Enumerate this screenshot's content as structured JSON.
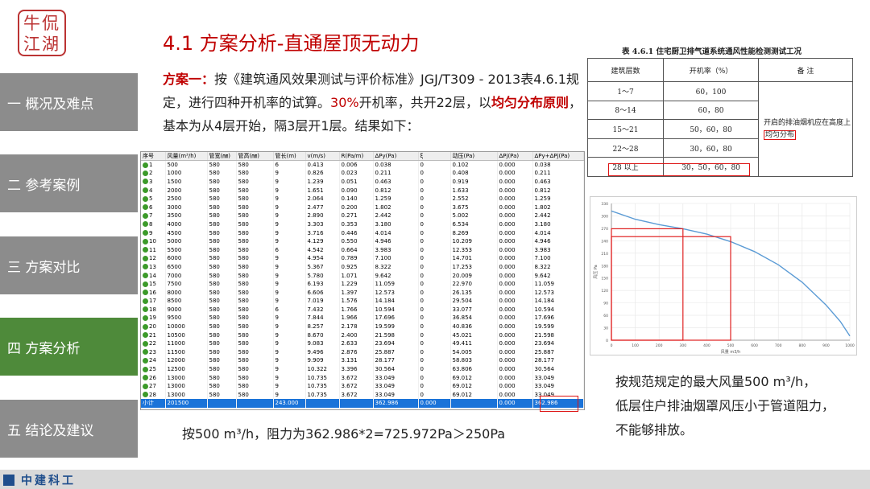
{
  "logo": {
    "text": "牛侃江湖"
  },
  "title": "4.1  方案分析-直通屋顶无动力",
  "sidebar": [
    {
      "label": "一 概况及难点",
      "active": false
    },
    {
      "label": "二 参考案例",
      "active": false
    },
    {
      "label": "三 方案对比",
      "active": false
    },
    {
      "label": "四 方案分析",
      "active": true
    },
    {
      "label": "五 结论及建议",
      "active": false
    }
  ],
  "paragraph": {
    "p1": "方案一：",
    "p2": "按《建筑通风效果测试与评价标准》JGJ/T309 - 2013表4.6.1规定，进行四种开机率的试算。",
    "p3": "30%",
    "p4": "开机率，共开22层，以",
    "p5": "均匀分布原则",
    "p6": "，基本为从4层开始，隔3层开1层。结果如下："
  },
  "calc_table": {
    "headers": [
      "序号",
      "风量(m³/h)",
      "管宽(㎜)",
      "管高(㎜)",
      "管长(m)",
      "v(m/s)",
      "R(Pa/m)",
      "ΔPy(Pa)",
      "ξ",
      "动压(Pa)",
      "ΔPj(Pa)",
      "ΔPy+ΔPj(Pa)"
    ],
    "rows": [
      [
        "1",
        "500",
        "580",
        "580",
        "6",
        "0.413",
        "0.006",
        "0.038",
        "0",
        "0.102",
        "0.000",
        "0.038"
      ],
      [
        "2",
        "1000",
        "580",
        "580",
        "9",
        "0.826",
        "0.023",
        "0.211",
        "0",
        "0.408",
        "0.000",
        "0.211"
      ],
      [
        "3",
        "1500",
        "580",
        "580",
        "9",
        "1.239",
        "0.051",
        "0.463",
        "0",
        "0.919",
        "0.000",
        "0.463"
      ],
      [
        "4",
        "2000",
        "580",
        "580",
        "9",
        "1.651",
        "0.090",
        "0.812",
        "0",
        "1.633",
        "0.000",
        "0.812"
      ],
      [
        "5",
        "2500",
        "580",
        "580",
        "9",
        "2.064",
        "0.140",
        "1.259",
        "0",
        "2.552",
        "0.000",
        "1.259"
      ],
      [
        "6",
        "3000",
        "580",
        "580",
        "9",
        "2.477",
        "0.200",
        "1.802",
        "0",
        "3.675",
        "0.000",
        "1.802"
      ],
      [
        "7",
        "3500",
        "580",
        "580",
        "9",
        "2.890",
        "0.271",
        "2.442",
        "0",
        "5.002",
        "0.000",
        "2.442"
      ],
      [
        "8",
        "4000",
        "580",
        "580",
        "9",
        "3.303",
        "0.353",
        "3.180",
        "0",
        "6.534",
        "0.000",
        "3.180"
      ],
      [
        "9",
        "4500",
        "580",
        "580",
        "9",
        "3.716",
        "0.446",
        "4.014",
        "0",
        "8.269",
        "0.000",
        "4.014"
      ],
      [
        "10",
        "5000",
        "580",
        "580",
        "9",
        "4.129",
        "0.550",
        "4.946",
        "0",
        "10.209",
        "0.000",
        "4.946"
      ],
      [
        "11",
        "5500",
        "580",
        "580",
        "6",
        "4.542",
        "0.664",
        "3.983",
        "0",
        "12.353",
        "0.000",
        "3.983"
      ],
      [
        "12",
        "6000",
        "580",
        "580",
        "9",
        "4.954",
        "0.789",
        "7.100",
        "0",
        "14.701",
        "0.000",
        "7.100"
      ],
      [
        "13",
        "6500",
        "580",
        "580",
        "9",
        "5.367",
        "0.925",
        "8.322",
        "0",
        "17.253",
        "0.000",
        "8.322"
      ],
      [
        "14",
        "7000",
        "580",
        "580",
        "9",
        "5.780",
        "1.071",
        "9.642",
        "0",
        "20.009",
        "0.000",
        "9.642"
      ],
      [
        "15",
        "7500",
        "580",
        "580",
        "9",
        "6.193",
        "1.229",
        "11.059",
        "0",
        "22.970",
        "0.000",
        "11.059"
      ],
      [
        "16",
        "8000",
        "580",
        "580",
        "9",
        "6.606",
        "1.397",
        "12.573",
        "0",
        "26.135",
        "0.000",
        "12.573"
      ],
      [
        "17",
        "8500",
        "580",
        "580",
        "9",
        "7.019",
        "1.576",
        "14.184",
        "0",
        "29.504",
        "0.000",
        "14.184"
      ],
      [
        "18",
        "9000",
        "580",
        "580",
        "6",
        "7.432",
        "1.766",
        "10.594",
        "0",
        "33.077",
        "0.000",
        "10.594"
      ],
      [
        "19",
        "9500",
        "580",
        "580",
        "9",
        "7.844",
        "1.966",
        "17.696",
        "0",
        "36.854",
        "0.000",
        "17.696"
      ],
      [
        "20",
        "10000",
        "580",
        "580",
        "9",
        "8.257",
        "2.178",
        "19.599",
        "0",
        "40.836",
        "0.000",
        "19.599"
      ],
      [
        "21",
        "10500",
        "580",
        "580",
        "9",
        "8.670",
        "2.400",
        "21.598",
        "0",
        "45.021",
        "0.000",
        "21.598"
      ],
      [
        "22",
        "11000",
        "580",
        "580",
        "9",
        "9.083",
        "2.633",
        "23.694",
        "0",
        "49.411",
        "0.000",
        "23.694"
      ],
      [
        "23",
        "11500",
        "580",
        "580",
        "9",
        "9.496",
        "2.876",
        "25.887",
        "0",
        "54.005",
        "0.000",
        "25.887"
      ],
      [
        "24",
        "12000",
        "580",
        "580",
        "9",
        "9.909",
        "3.131",
        "28.177",
        "0",
        "58.803",
        "0.000",
        "28.177"
      ],
      [
        "25",
        "12500",
        "580",
        "580",
        "9",
        "10.322",
        "3.396",
        "30.564",
        "0",
        "63.806",
        "0.000",
        "30.564"
      ],
      [
        "26",
        "13000",
        "580",
        "580",
        "9",
        "10.735",
        "3.672",
        "33.049",
        "0",
        "69.012",
        "0.000",
        "33.049"
      ],
      [
        "27",
        "13000",
        "580",
        "580",
        "9",
        "10.735",
        "3.672",
        "33.049",
        "0",
        "69.012",
        "0.000",
        "33.049"
      ],
      [
        "28",
        "13000",
        "580",
        "580",
        "9",
        "10.735",
        "3.672",
        "33.049",
        "0",
        "69.012",
        "0.000",
        "33.049"
      ]
    ],
    "sum_row": [
      "小计",
      "201500",
      "",
      "",
      "243.000",
      "",
      "",
      "362.986",
      "0.000",
      "",
      "0.000",
      "362.986"
    ]
  },
  "ref_table": {
    "caption": "表 4.6.1  住宅厨卫排气道系统通风性能检测测试工况",
    "headers": [
      "建筑层数",
      "开机率（%）",
      "备    注"
    ],
    "rows": [
      [
        "1～7",
        "60，100"
      ],
      [
        "8～14",
        "60，80"
      ],
      [
        "15～21",
        "50，60，80"
      ],
      [
        "22～28",
        "30，60，80"
      ],
      [
        "28 以上",
        "30，50，60，80"
      ]
    ],
    "note_pre": "开启的排油烟机应在高度上",
    "note_box": "均匀分布"
  },
  "chart_data": {
    "type": "line",
    "xlabel": "风量 m3/h",
    "ylabel": "风压 Pa",
    "xlim": [
      0,
      1000
    ],
    "ylim": [
      0,
      330
    ],
    "xticks": [
      0,
      100,
      200,
      300,
      400,
      500,
      600,
      700,
      800,
      900,
      1000
    ],
    "yticks": [
      0,
      30,
      60,
      90,
      120,
      150,
      180,
      210,
      240,
      270,
      300,
      330
    ],
    "series": [
      {
        "x": [
          0,
          100,
          200,
          300,
          400,
          500,
          600,
          700,
          800,
          900,
          960,
          1000
        ],
        "y": [
          312,
          292,
          279,
          269,
          256,
          238,
          214,
          182,
          140,
          85,
          45,
          10
        ]
      }
    ],
    "markers": [
      {
        "x": 300,
        "y": 269
      },
      {
        "x": 500,
        "y": 250
      }
    ],
    "colors": {
      "line": "#5b9bd5",
      "marker": "#e02020"
    }
  },
  "notes": {
    "line1": "按规范规定的最大风量500 m³/h，",
    "line2": "低层住户排油烟罩风压小于管道阻力，",
    "line3": "不能够排放。"
  },
  "bottom_text": "按500 m³/h，阻力为362.986*2=725.972Pa＞250Pa",
  "footer": {
    "logo_text": "中建科工"
  }
}
